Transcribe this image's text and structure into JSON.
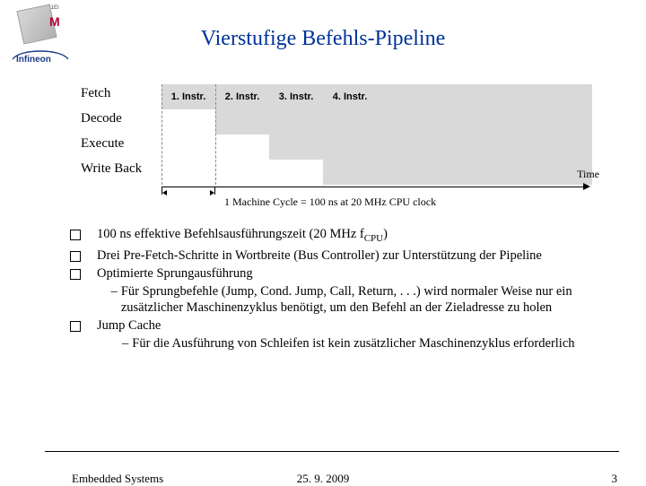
{
  "header": {
    "logo_label": "G1EI",
    "logo_m": "M"
  },
  "title": "Vierstufige Befehls-Pipeline",
  "pipeline": {
    "stages": [
      "Fetch",
      "Decode",
      "Execute",
      "Write Back"
    ],
    "cells": [
      "1. Instr.",
      "2. Instr.",
      "3. Instr.",
      "4. Instr."
    ],
    "time_label": "Time",
    "cycle_text": "1 Machine Cycle = 100 ns at 20 MHz CPU clock"
  },
  "bullets": {
    "b1a": "100 ns effektive Befehlsausführungszeit (20 MHz f",
    "b1b": ")",
    "b1_sub": "CPU",
    "b2": "Drei Pre-Fetch-Schritte in Wortbreite (Bus Controller) zur Unterstützung der Pipeline",
    "b3": "Optimierte Sprungausführung",
    "b3s1": "Für Sprungbefehle (Jump, Cond. Jump, Call, Return, . . .) wird normaler Weise nur ein zusätzlicher Maschinenzyklus benötigt, um den Befehl an der Zieladresse zu holen",
    "b4": "Jump Cache",
    "b4s1": "Für die Ausführung von Schleifen ist kein zusätzlicher Maschinenzyklus erforderlich"
  },
  "footer": {
    "left": "Embedded Systems",
    "center": "25. 9. 2009",
    "right": "3"
  }
}
